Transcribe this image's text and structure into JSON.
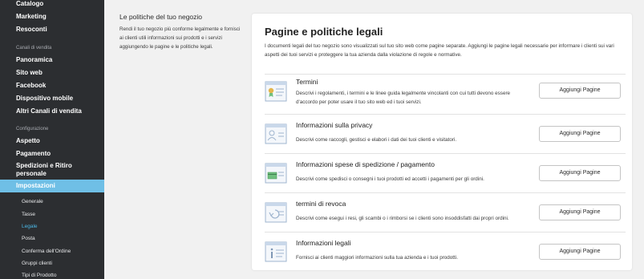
{
  "sidebar": {
    "top_items": [
      "Catalogo",
      "Marketing",
      "Resoconti"
    ],
    "sales_section_label": "Canali di vendita",
    "sales_items": [
      "Panoramica",
      "Sito web",
      "Facebook",
      "Dispositivo mobile",
      "Altri Canali di vendita"
    ],
    "config_section_label": "Configurazione",
    "config_items": [
      "Aspetto",
      "Pagamento",
      "Spedizioni e Ritiro personale"
    ],
    "active_item": "Impostazioni",
    "sub_items": [
      {
        "label": "Generale",
        "active": false
      },
      {
        "label": "Tasse",
        "active": false
      },
      {
        "label": "Legale",
        "active": true
      },
      {
        "label": "Posta",
        "active": false
      },
      {
        "label": "Conferma dell'Ordine",
        "active": false
      },
      {
        "label": "Gruppi clienti",
        "active": false
      },
      {
        "label": "Tipi di Prodotto",
        "active": false
      }
    ]
  },
  "description": {
    "title": "Le politiche del tuo negozio",
    "text": "Rendi il tuo negozio più conforme legalmente e fornisci ai clienti utili informazioni sui prodotti e i servizi aggiungendo le pagine e le politiche legali."
  },
  "card": {
    "title": "Pagine e politiche legali",
    "intro": "I documenti legali del tuo negozio sono visualizzati sul tuo sito web come pagine separate. Aggiungi le pagine legali necessarie per informare i clienti sui vari aspetti dei tuoi servizi e proteggere la tua azienda dalla violazione di regole e normative.",
    "rows": [
      {
        "icon": "certificate-document-icon",
        "title": "Termini",
        "desc": "Descrivi i regolamenti, i termini e le linee guida legalmente vincolanti con cui tutti devono essere d'accordo per poter usare il tuo sito web ed i tuoi servizi.",
        "button": "Aggiungi Pagine"
      },
      {
        "icon": "user-profile-icon",
        "title": "Informazioni sulla privacy",
        "desc": "Descrivi come raccogli, gestisci e elabori i dati dei tuoi clienti e visitatori.",
        "button": "Aggiungi Pagine"
      },
      {
        "icon": "credit-card-icon",
        "title": "Informazioni spese di spedizione / pagamento",
        "desc": "Descrivi come spedisci o consegni i tuoi prodotti ed accetti i pagamenti per gli ordini.",
        "button": "Aggiungi Pagine"
      },
      {
        "icon": "return-arrow-icon",
        "title": "termini di revoca",
        "desc": "Descrivi come esegui i resi, gli scambi o i rimborsi se i clienti sono insoddisfatti dai propri ordini.",
        "button": "Aggiungi Pagine"
      },
      {
        "icon": "info-icon",
        "title": "Informazioni legali",
        "desc": "Fornisci ai clienti maggiori informazioni sulla tua azienda e i tuoi prodotti.",
        "button": "Aggiungi Pagine"
      }
    ]
  },
  "colors": {
    "sidebar_bg": "#2c2e31",
    "sidebar_active_bg": "#6fbfe6",
    "sidebar_sub_active": "#4bb8e6",
    "icon_accent": "#9fb5cf",
    "icon_green": "#6fbf7e",
    "icon_gold": "#e3b54b"
  }
}
